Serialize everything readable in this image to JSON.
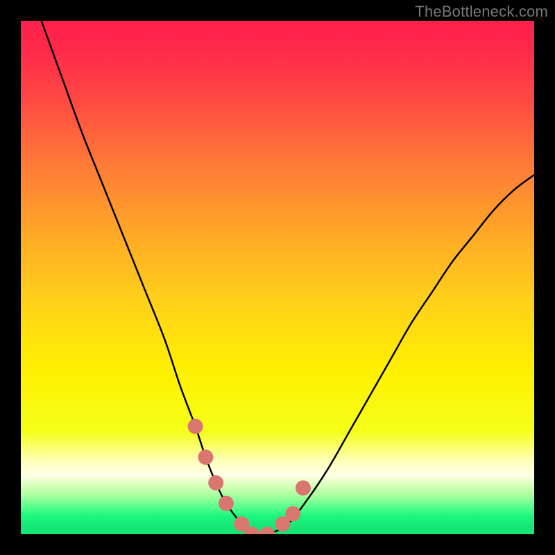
{
  "watermark": "TheBottleneck.com",
  "colors": {
    "frame": "#000000",
    "curve": "#000000",
    "marker_fill": "#d9766f",
    "marker_stroke": "#c95e57",
    "gradient_stops": [
      {
        "offset": 0.0,
        "color": "#ff1f4b"
      },
      {
        "offset": 0.06,
        "color": "#ff2a4a"
      },
      {
        "offset": 0.15,
        "color": "#ff4843"
      },
      {
        "offset": 0.28,
        "color": "#ff7a38"
      },
      {
        "offset": 0.42,
        "color": "#ffaa26"
      },
      {
        "offset": 0.55,
        "color": "#ffd21a"
      },
      {
        "offset": 0.68,
        "color": "#fff000"
      },
      {
        "offset": 0.8,
        "color": "#f5ff1a"
      },
      {
        "offset": 0.86,
        "color": "#ffffc0"
      },
      {
        "offset": 0.885,
        "color": "#ffffe6"
      },
      {
        "offset": 0.905,
        "color": "#d8ffb8"
      },
      {
        "offset": 0.925,
        "color": "#a6ff9e"
      },
      {
        "offset": 0.945,
        "color": "#5fff8e"
      },
      {
        "offset": 0.965,
        "color": "#1cf77f"
      },
      {
        "offset": 0.985,
        "color": "#17e676"
      },
      {
        "offset": 1.0,
        "color": "#17e676"
      }
    ]
  },
  "chart_data": {
    "type": "line",
    "title": "",
    "xlabel": "",
    "ylabel": "",
    "xlim": [
      0,
      100
    ],
    "ylim": [
      0,
      100
    ],
    "series": [
      {
        "name": "bottleneck-curve",
        "x": [
          4,
          8,
          12,
          16,
          20,
          24,
          28,
          31,
          34,
          36,
          38,
          40,
          43,
          45,
          48,
          52,
          56,
          60,
          64,
          68,
          72,
          76,
          80,
          84,
          88,
          92,
          96,
          100
        ],
        "y": [
          100,
          89,
          78,
          68,
          58,
          48,
          38,
          29,
          21,
          15,
          10,
          6,
          2,
          0,
          0,
          2,
          7,
          13,
          20,
          27,
          34,
          41,
          47,
          53,
          58,
          63,
          67,
          70
        ]
      }
    ],
    "markers": {
      "name": "highlight-points",
      "x": [
        34,
        36,
        38,
        40,
        43,
        45,
        48,
        51,
        53,
        55
      ],
      "y": [
        21,
        15,
        10,
        6,
        2,
        0,
        0,
        2,
        4,
        9
      ]
    }
  }
}
